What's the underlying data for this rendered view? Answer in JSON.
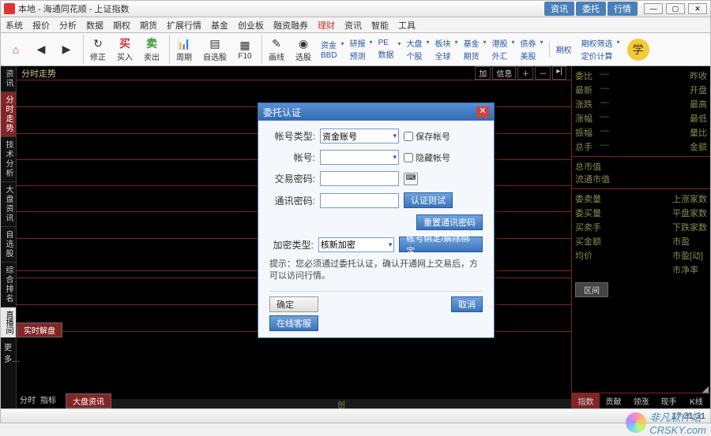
{
  "title": "本地 - 海通同花顺 - 上证指数",
  "title_tabs": [
    "资讯",
    "委托",
    "行情"
  ],
  "menu": [
    "系统",
    "报价",
    "分析",
    "数据",
    "期权",
    "期货",
    "扩展行情",
    "基金",
    "创业板",
    "融资融券",
    "理财",
    "资讯",
    "智能",
    "工具"
  ],
  "menu_red_index": 10,
  "toolbar": {
    "home": "⌂",
    "back": "‹",
    "fwd": "›",
    "fix": "修正",
    "buy": "买入",
    "buy_ch": "买",
    "sell": "卖出",
    "sell_ch": "卖",
    "period": "周期",
    "self": "自选股",
    "f10": "F10",
    "draw": "画线",
    "select": "选股",
    "fund": "资金",
    "bbd": "BBD",
    "research": "研报",
    "forecast": "预测",
    "pe": "PE",
    "data": "数据",
    "big": "大盘",
    "indiv": "个股",
    "block": "板块",
    "fund2": "基金",
    "futures": "期货",
    "global": "全球",
    "hk": "港股",
    "forex": "外汇",
    "bond": "债券",
    "us": "美股",
    "option": "期权",
    "opt_filter": "期权筛选",
    "price_calc": "定价计算",
    "learn": "学"
  },
  "sidebar": [
    "资讯",
    "分时走势",
    "技术分析",
    "大盘资讯",
    "自选股",
    "综合排名"
  ],
  "sidebar_live": "直播间",
  "sidebar_more": "更多",
  "chart": {
    "title": "分时走势",
    "btns": [
      "加",
      "信息",
      "＋",
      "－",
      "▸|"
    ],
    "tab1": "实时解盘",
    "label1": "分时",
    "label2": "指标",
    "info": "大盘资讯",
    "scroll": "创"
  },
  "right": {
    "r1": "委比",
    "r1b": "昨收",
    "r2": "最新",
    "r2b": "开盘",
    "r3": "涨跌",
    "r3b": "最高",
    "r4": "涨幅",
    "r4b": "最低",
    "r5": "振幅",
    "r5b": "量比",
    "r6": "总手",
    "r6b": "金额",
    "s1": "总市值",
    "s2": "流通市值",
    "p1": "委卖量",
    "p1b": "上涨家数",
    "p2": "委买量",
    "p2b": "平盘家数",
    "p3": "买卖手",
    "p3b": "下跌家数",
    "p4": "买金额",
    "p5": "均价",
    "p5b": "市盈",
    "p5c": "市盈[动]",
    "p5d": "市净率",
    "btn": "区间",
    "tabs": [
      "指数",
      "贡献",
      "领涨",
      "现手",
      "K线"
    ]
  },
  "dialog": {
    "title": "委托认证",
    "acct_type_l": "帐号类型:",
    "acct_type_v": "资金账号",
    "save_acct": "保存帐号",
    "acct_l": "帐号:",
    "hide_acct": "隐藏帐号",
    "trade_pw_l": "交易密码:",
    "comm_pw_l": "通讯密码:",
    "test": "认证则试",
    "reset_pw": "重置通讯密码",
    "enc_l": "加密类型:",
    "enc_v": "核新加密",
    "bind": "帐号绑定/解除绑定",
    "hint_l": "提示：",
    "hint": "您必须通过委托认证，确认开通网上交易后，方可以访问行情。",
    "ok": "确定",
    "cancel": "取消",
    "service": "在线客服"
  },
  "status": {
    "time": "17:31:31"
  },
  "watermark": {
    "l1": "非凡软件站",
    "l2": "CRSKY.com"
  }
}
